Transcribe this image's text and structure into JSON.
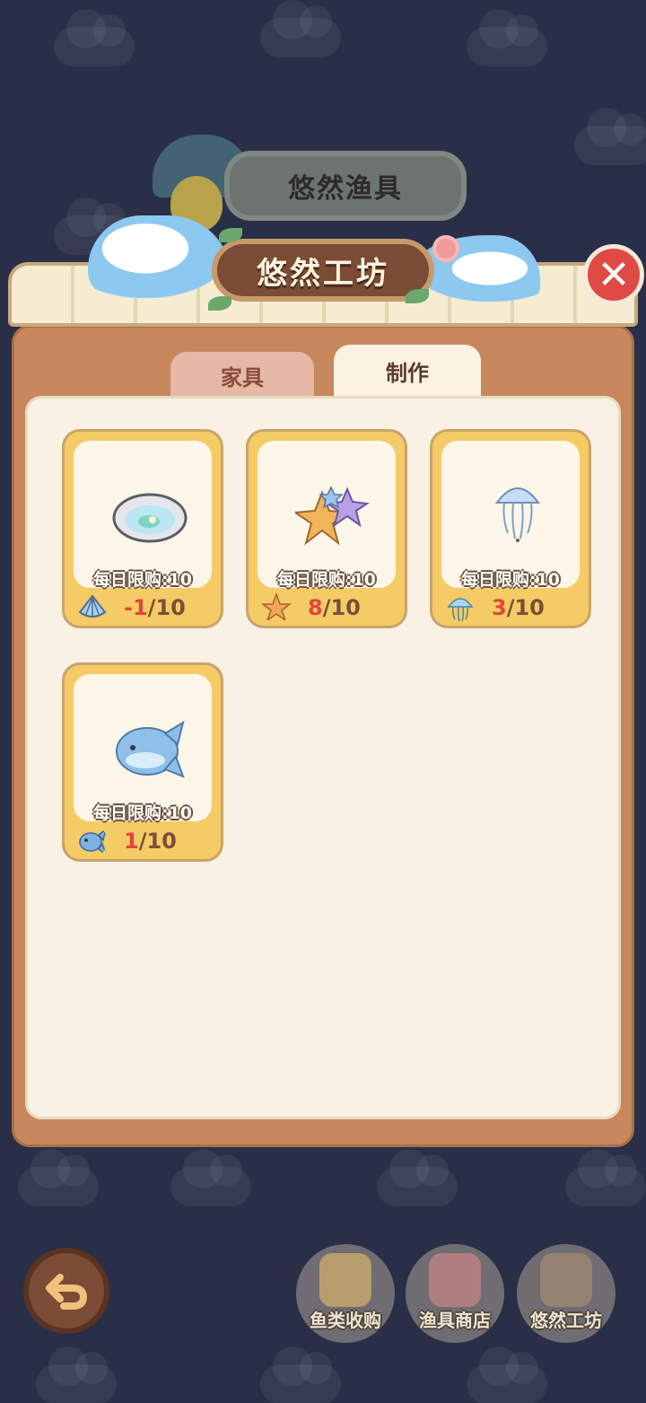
{
  "colors": {
    "background": "#2a2f48",
    "panel": "#c9875e",
    "card": "#f5cb66",
    "count_highlight": "#e1473b",
    "close": "#e04a45"
  },
  "top_sign": {
    "title": "悠然渔具"
  },
  "panel": {
    "title": "悠然工坊"
  },
  "tabs": [
    {
      "label": "家具",
      "active": false
    },
    {
      "label": "制作",
      "active": true
    }
  ],
  "items": [
    {
      "icon": "oyster-pool-icon",
      "limit_text": "每日限购:10",
      "material_icon": "shell-icon",
      "have": "-1",
      "need": "/10"
    },
    {
      "icon": "starfish-rug-icon",
      "limit_text": "每日限购:10",
      "material_icon": "starfish-icon",
      "have": "8",
      "need": "/10"
    },
    {
      "icon": "jellyfish-lamp-icon",
      "limit_text": "每日限购:10",
      "material_icon": "jellyfish-icon",
      "have": "3",
      "need": "/10"
    },
    {
      "icon": "sunfish-plush-icon",
      "limit_text": "每日限购:10",
      "material_icon": "sunfish-icon",
      "have": "1",
      "need": "/10"
    }
  ],
  "bottom_nav": [
    {
      "label": "鱼类收购",
      "icon": "fish-jar-icon"
    },
    {
      "label": "渔具商店",
      "icon": "shop-icon"
    },
    {
      "label": "悠然工坊",
      "icon": "hammer-icon"
    }
  ]
}
